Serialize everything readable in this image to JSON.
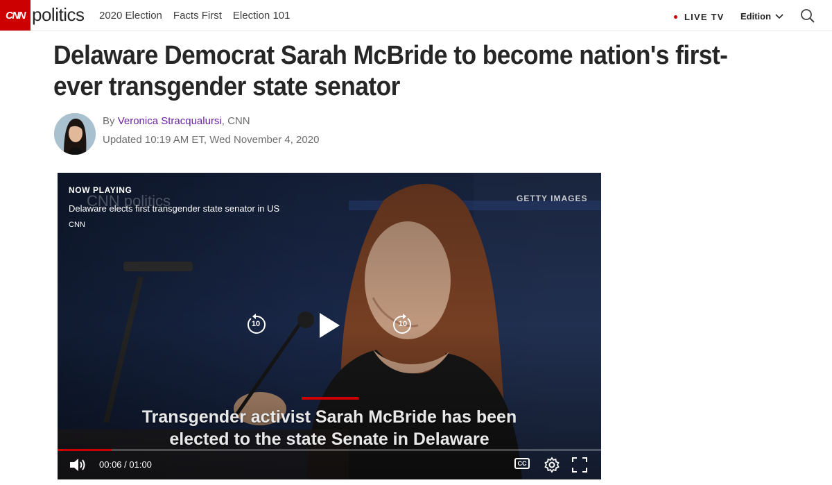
{
  "header": {
    "logo_text": "CNN",
    "section": "politics",
    "nav": [
      "2020 Election",
      "Facts First",
      "Election 101"
    ],
    "live_tv": "LIVE TV",
    "edition": "Edition",
    "accent_color": "#cc0000"
  },
  "article": {
    "headline": "Delaware Democrat Sarah McBride to become nation's first-ever transgender state senator",
    "by_prefix": "By ",
    "author": "Veronica Stracqualursi",
    "outlet": ", CNN",
    "updated": "Updated 10:19 AM ET, Wed November 4, 2020"
  },
  "video": {
    "now_playing": "NOW PLAYING",
    "title": "Delaware elects first transgender state senator in US",
    "source": "CNN",
    "credit": "GETTY IMAGES",
    "watermark": "CNN politics",
    "subtitle_line1": "Transgender activist Sarah McBride has been",
    "subtitle_line2": "elected to the state Senate in Delaware",
    "skip_back": "10",
    "skip_forward": "10",
    "time_display": "00:06 / 01:00",
    "progress": 0.1,
    "cc_label": "CC"
  }
}
